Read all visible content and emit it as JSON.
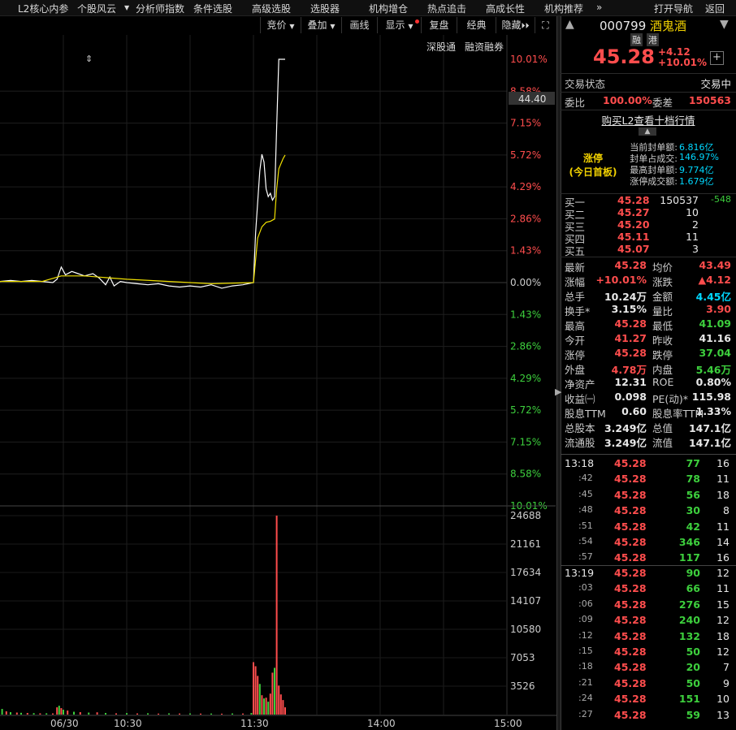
{
  "menu": [
    {
      "label": "L2核心内参",
      "arrow": false
    },
    {
      "label": "个股风云",
      "arrow": true
    },
    {
      "label": "分析师指数",
      "arrow": false
    },
    {
      "label": "条件选股",
      "arrow": false
    },
    {
      "label": "高级选股",
      "arrow": false
    },
    {
      "label": "选股器",
      "arrow": false
    },
    {
      "label": "机构增仓",
      "arrow": false
    },
    {
      "label": "热点追击",
      "arrow": false
    },
    {
      "label": "高成长性",
      "arrow": false
    },
    {
      "label": "机构推荐",
      "arrow": false
    },
    {
      "label": "»",
      "arrow": false
    }
  ],
  "menu_right": {
    "nav": "打开导航",
    "back": "返回"
  },
  "toolbar": {
    "bid": "竞价",
    "overlay": "叠加",
    "draw": "画线",
    "display": "显示",
    "review": "复盘",
    "classic": "经典",
    "hide": "隐藏"
  },
  "subtabs": {
    "sgt": "深股通",
    "margin": "融资融券"
  },
  "stock": {
    "code": "000799",
    "name": "酒鬼酒",
    "tag_margin": "融",
    "tag_hk": "港",
    "price": "45.28",
    "change": "+4.12",
    "change_pct": "+10.01%"
  },
  "status": {
    "label": "交易状态",
    "value": "交易中"
  },
  "commission": {
    "ratio_label": "委比",
    "ratio": "100.00%",
    "diff_label": "委差",
    "diff": "150563"
  },
  "l2_link": "购买L2查看十档行情",
  "limit_up": {
    "title": "涨停",
    "subtitle": "(今日首板)",
    "rows": [
      {
        "label": "当前封单额:",
        "value": "6.816亿"
      },
      {
        "label": "封单占成交:",
        "value": "146.97%"
      },
      {
        "label": "最高封单额:",
        "value": "9.774亿"
      },
      {
        "label": "涨停成交额:",
        "value": "1.679亿"
      }
    ]
  },
  "bids": [
    {
      "label": "买一",
      "price": "45.28",
      "vol": "150537",
      "chg": "-548"
    },
    {
      "label": "买二",
      "price": "45.27",
      "vol": "10",
      "chg": ""
    },
    {
      "label": "买三",
      "price": "45.20",
      "vol": "2",
      "chg": ""
    },
    {
      "label": "买四",
      "price": "45.11",
      "vol": "11",
      "chg": ""
    },
    {
      "label": "买五",
      "price": "45.07",
      "vol": "3",
      "chg": ""
    }
  ],
  "quote": [
    [
      {
        "l": "最新",
        "v": "45.28",
        "c": "red"
      },
      {
        "l": "均价",
        "v": "43.49",
        "c": "red"
      }
    ],
    [
      {
        "l": "涨幅",
        "v": "+10.01%",
        "c": "red"
      },
      {
        "l": "涨跌",
        "v": "▲4.12",
        "c": "red"
      }
    ],
    [
      {
        "l": "总手",
        "v": "10.24万",
        "c": "white"
      },
      {
        "l": "金额",
        "v": "4.45亿",
        "c": "cyan"
      }
    ],
    [
      {
        "l": "换手*",
        "v": "3.15%",
        "c": "white"
      },
      {
        "l": "量比",
        "v": "3.90",
        "c": "red"
      }
    ],
    [
      {
        "l": "最高",
        "v": "45.28",
        "c": "red"
      },
      {
        "l": "最低",
        "v": "41.09",
        "c": "green"
      }
    ],
    [
      {
        "l": "今开",
        "v": "41.27",
        "c": "red"
      },
      {
        "l": "昨收",
        "v": "41.16",
        "c": "white"
      }
    ],
    [
      {
        "l": "涨停",
        "v": "45.28",
        "c": "red"
      },
      {
        "l": "跌停",
        "v": "37.04",
        "c": "green"
      }
    ],
    [
      {
        "l": "外盘",
        "v": "4.78万",
        "c": "red"
      },
      {
        "l": "内盘",
        "v": "5.46万",
        "c": "green"
      }
    ],
    [
      {
        "l": "净资产",
        "v": "12.31",
        "c": "white"
      },
      {
        "l": "ROE",
        "v": "0.80%",
        "c": "white"
      }
    ],
    [
      {
        "l": "收益㈠",
        "v": "0.098",
        "c": "white"
      },
      {
        "l": "PE(动)*",
        "v": "115.98",
        "c": "white"
      }
    ],
    [
      {
        "l": "股息TTM",
        "v": "0.60",
        "c": "white"
      },
      {
        "l": "股息率TTM",
        "v": "1.33%",
        "c": "white"
      }
    ],
    [
      {
        "l": "总股本",
        "v": "3.249亿",
        "c": "white"
      },
      {
        "l": "总值",
        "v": "147.1亿",
        "c": "white"
      }
    ],
    [
      {
        "l": "流通股",
        "v": "3.249亿",
        "c": "white"
      },
      {
        "l": "流值",
        "v": "147.1亿",
        "c": "white"
      }
    ]
  ],
  "ticks_group1": [
    {
      "t": "13:18",
      "p": "45.28",
      "v": "77",
      "n": "16"
    },
    {
      "t": ":42",
      "p": "45.28",
      "v": "78",
      "n": "11"
    },
    {
      "t": ":45",
      "p": "45.28",
      "v": "56",
      "n": "18"
    },
    {
      "t": ":48",
      "p": "45.28",
      "v": "30",
      "n": "8"
    },
    {
      "t": ":51",
      "p": "45.28",
      "v": "42",
      "n": "11"
    },
    {
      "t": ":54",
      "p": "45.28",
      "v": "346",
      "n": "14"
    },
    {
      "t": ":57",
      "p": "45.28",
      "v": "117",
      "n": "16"
    }
  ],
  "ticks_group2": [
    {
      "t": "13:19",
      "p": "45.28",
      "v": "90",
      "n": "12"
    },
    {
      "t": ":03",
      "p": "45.28",
      "v": "66",
      "n": "11"
    },
    {
      "t": ":06",
      "p": "45.28",
      "v": "276",
      "n": "15"
    },
    {
      "t": ":09",
      "p": "45.28",
      "v": "240",
      "n": "12"
    },
    {
      "t": ":12",
      "p": "45.28",
      "v": "132",
      "n": "18"
    },
    {
      "t": ":15",
      "p": "45.28",
      "v": "50",
      "n": "12"
    },
    {
      "t": ":18",
      "p": "45.28",
      "v": "20",
      "n": "7"
    },
    {
      "t": ":21",
      "p": "45.28",
      "v": "50",
      "n": "9"
    },
    {
      "t": ":24",
      "p": "45.28",
      "v": "151",
      "n": "10"
    },
    {
      "t": ":27",
      "p": "45.28",
      "v": "59",
      "n": "13"
    }
  ],
  "chart_data": {
    "type": "line",
    "price_axis_right_pct": [
      "10.01%",
      "8.58%",
      "7.15%",
      "5.72%",
      "4.29%",
      "2.86%",
      "1.43%",
      "0.00%",
      "1.43%",
      "2.86%",
      "4.29%",
      "5.72%",
      "7.15%",
      "8.58%",
      "10.01%"
    ],
    "price_ylim_pct": [
      -10.01,
      10.01
    ],
    "cursor_price": "44.40",
    "volume_axis": [
      "24688",
      "21161",
      "17634",
      "14107",
      "10580",
      "7053",
      "3526"
    ],
    "volume_ylim": [
      0,
      24688
    ],
    "x_ticks": [
      "06/30",
      "10:30",
      "11:30",
      "14:00",
      "15:00"
    ],
    "xlim_minutes": [
      0,
      240
    ],
    "series": [
      {
        "key": "price",
        "color": "#ffffff",
        "points": [
          [
            0,
            0.05
          ],
          [
            5,
            0.1
          ],
          [
            10,
            0.05
          ],
          [
            15,
            0.1
          ],
          [
            20,
            0.05
          ],
          [
            25,
            0.0
          ],
          [
            27,
            0.15
          ],
          [
            29,
            0.7
          ],
          [
            31,
            0.35
          ],
          [
            34,
            0.5
          ],
          [
            37,
            0.4
          ],
          [
            40,
            0.3
          ],
          [
            44,
            0.4
          ],
          [
            47,
            0.2
          ],
          [
            50,
            -0.1
          ],
          [
            52,
            0.25
          ],
          [
            54,
            -0.15
          ],
          [
            57,
            0.05
          ],
          [
            60,
            0.0
          ],
          [
            65,
            -0.05
          ],
          [
            70,
            -0.1
          ],
          [
            75,
            -0.05
          ],
          [
            80,
            -0.15
          ],
          [
            85,
            -0.2
          ],
          [
            90,
            -0.15
          ],
          [
            95,
            -0.2
          ],
          [
            100,
            -0.1
          ],
          [
            105,
            -0.25
          ],
          [
            110,
            -0.15
          ],
          [
            115,
            -0.1
          ],
          [
            120,
            0.0
          ],
          [
            121,
            2.2
          ],
          [
            123,
            5.0
          ],
          [
            124,
            5.75
          ],
          [
            125,
            5.4
          ],
          [
            126,
            4.2
          ],
          [
            127,
            3.85
          ],
          [
            128,
            4.0
          ],
          [
            129,
            3.7
          ],
          [
            130,
            3.85
          ],
          [
            131,
            7.0
          ],
          [
            132,
            10.01
          ],
          [
            135,
            10.01
          ]
        ]
      },
      {
        "key": "avg",
        "color": "#f0e000",
        "points": [
          [
            0,
            0.05
          ],
          [
            20,
            0.05
          ],
          [
            29,
            0.3
          ],
          [
            40,
            0.3
          ],
          [
            60,
            0.15
          ],
          [
            80,
            0.05
          ],
          [
            100,
            -0.05
          ],
          [
            120,
            0.0
          ],
          [
            122,
            2.0
          ],
          [
            124,
            2.5
          ],
          [
            126,
            2.7
          ],
          [
            128,
            2.75
          ],
          [
            130,
            2.85
          ],
          [
            131,
            4.2
          ],
          [
            132,
            5.1
          ],
          [
            134,
            5.55
          ],
          [
            135,
            5.72
          ]
        ]
      }
    ],
    "volume_bars": [
      {
        "m": 1,
        "v": 700,
        "c": "g"
      },
      {
        "m": 3,
        "v": 400,
        "c": "r"
      },
      {
        "m": 5,
        "v": 300,
        "c": "g"
      },
      {
        "m": 8,
        "v": 250,
        "c": "r"
      },
      {
        "m": 10,
        "v": 220,
        "c": "g"
      },
      {
        "m": 13,
        "v": 200,
        "c": "r"
      },
      {
        "m": 16,
        "v": 180,
        "c": "g"
      },
      {
        "m": 19,
        "v": 150,
        "c": "r"
      },
      {
        "m": 22,
        "v": 160,
        "c": "g"
      },
      {
        "m": 25,
        "v": 140,
        "c": "r"
      },
      {
        "m": 27,
        "v": 900,
        "c": "r"
      },
      {
        "m": 28,
        "v": 1100,
        "c": "g"
      },
      {
        "m": 29,
        "v": 800,
        "c": "r"
      },
      {
        "m": 30,
        "v": 600,
        "c": "g"
      },
      {
        "m": 32,
        "v": 500,
        "c": "r"
      },
      {
        "m": 35,
        "v": 350,
        "c": "g"
      },
      {
        "m": 38,
        "v": 300,
        "c": "r"
      },
      {
        "m": 42,
        "v": 250,
        "c": "g"
      },
      {
        "m": 46,
        "v": 280,
        "c": "r"
      },
      {
        "m": 50,
        "v": 200,
        "c": "g"
      },
      {
        "m": 55,
        "v": 150,
        "c": "r"
      },
      {
        "m": 60,
        "v": 180,
        "c": "g"
      },
      {
        "m": 65,
        "v": 140,
        "c": "r"
      },
      {
        "m": 70,
        "v": 160,
        "c": "g"
      },
      {
        "m": 75,
        "v": 120,
        "c": "r"
      },
      {
        "m": 80,
        "v": 150,
        "c": "g"
      },
      {
        "m": 85,
        "v": 130,
        "c": "r"
      },
      {
        "m": 90,
        "v": 140,
        "c": "g"
      },
      {
        "m": 95,
        "v": 120,
        "c": "r"
      },
      {
        "m": 100,
        "v": 130,
        "c": "g"
      },
      {
        "m": 105,
        "v": 110,
        "c": "r"
      },
      {
        "m": 110,
        "v": 140,
        "c": "g"
      },
      {
        "m": 115,
        "v": 130,
        "c": "r"
      },
      {
        "m": 119,
        "v": 200,
        "c": "g"
      },
      {
        "m": 120,
        "v": 6500,
        "c": "r"
      },
      {
        "m": 121,
        "v": 6000,
        "c": "r"
      },
      {
        "m": 122,
        "v": 4800,
        "c": "r"
      },
      {
        "m": 123,
        "v": 3800,
        "c": "g"
      },
      {
        "m": 124,
        "v": 2400,
        "c": "r"
      },
      {
        "m": 125,
        "v": 2000,
        "c": "g"
      },
      {
        "m": 126,
        "v": 2100,
        "c": "r"
      },
      {
        "m": 127,
        "v": 1600,
        "c": "g"
      },
      {
        "m": 128,
        "v": 2600,
        "c": "r"
      },
      {
        "m": 129,
        "v": 5200,
        "c": "r"
      },
      {
        "m": 130,
        "v": 5800,
        "c": "g"
      },
      {
        "m": 131,
        "v": 24688,
        "c": "r"
      },
      {
        "m": 132,
        "v": 3600,
        "c": "r"
      },
      {
        "m": 133,
        "v": 2500,
        "c": "r"
      },
      {
        "m": 134,
        "v": 1800,
        "c": "r"
      },
      {
        "m": 135,
        "v": 900,
        "c": "r"
      }
    ]
  }
}
